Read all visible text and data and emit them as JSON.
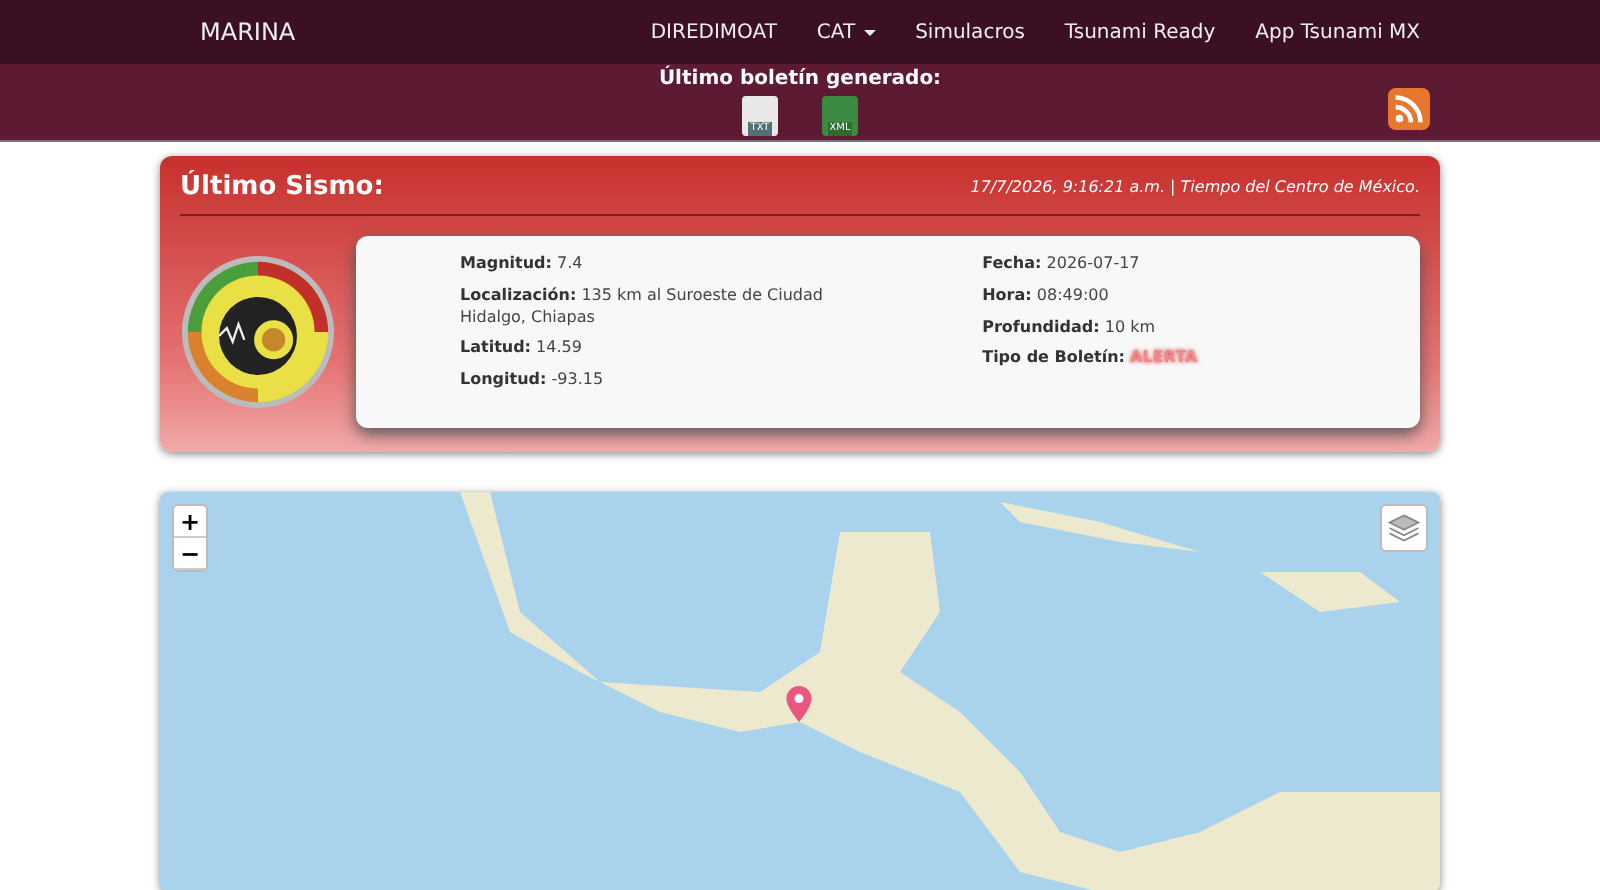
{
  "navbar": {
    "brand": "MARINA",
    "links": [
      {
        "label": "DIREDIMOAT",
        "dropdown": false
      },
      {
        "label": "CAT",
        "dropdown": true
      },
      {
        "label": "Simulacros",
        "dropdown": false
      },
      {
        "label": "Tsunami Ready",
        "dropdown": false
      },
      {
        "label": "App Tsunami MX",
        "dropdown": false
      }
    ]
  },
  "bulletin_bar": {
    "title": "Último boletín generado:",
    "files": [
      {
        "label": "TXT",
        "kind": "txt"
      },
      {
        "label": "XML",
        "kind": "xml"
      }
    ]
  },
  "quake": {
    "title": "Último Sismo:",
    "timestamp": "17/7/2026, 9:16:21 a.m. | Tiempo del Centro de México.",
    "left": [
      {
        "label": "Magnitud:",
        "value": "7.4"
      },
      {
        "label": "Localización:",
        "value": "135 km al Suroeste de Ciudad Hidalgo, Chiapas"
      },
      {
        "label": "Latitud:",
        "value": "14.59"
      },
      {
        "label": "Longitud:",
        "value": "-93.15"
      }
    ],
    "right": [
      {
        "label": "Fecha:",
        "value": "2026-07-17",
        "kind": "plain"
      },
      {
        "label": "Hora:",
        "value": "08:49:00",
        "kind": "plain"
      },
      {
        "label": "Profundidad:",
        "value": "10 km",
        "kind": "plain"
      },
      {
        "label": "Tipo de Boletín:",
        "value": "ALERTA",
        "kind": "alert"
      }
    ]
  },
  "map": {
    "zoom_in": "+",
    "zoom_out": "−"
  }
}
